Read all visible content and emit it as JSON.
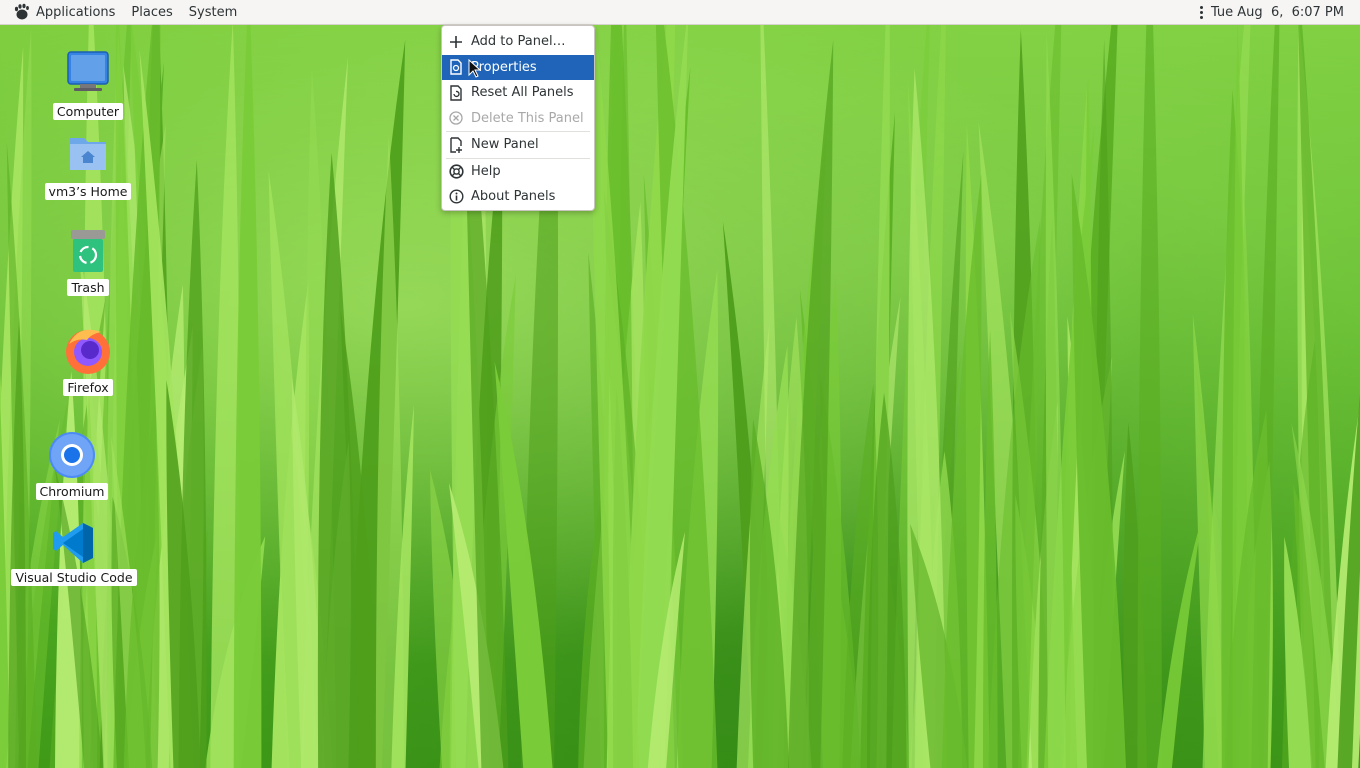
{
  "panel": {
    "menus": {
      "applications": "Applications",
      "places": "Places",
      "system": "System"
    },
    "clock": "Tue Aug  6,  6:07 PM"
  },
  "desktop": {
    "icons": [
      {
        "label": "Computer",
        "icon": "computer-icon"
      },
      {
        "label": "vm3’s Home",
        "icon": "home-folder-icon"
      },
      {
        "label": "Trash",
        "icon": "trash-icon"
      },
      {
        "label": "Firefox",
        "icon": "firefox-icon"
      },
      {
        "label": "Chromium",
        "icon": "chromium-icon"
      },
      {
        "label": "Visual Studio Code",
        "icon": "vscode-icon"
      }
    ]
  },
  "context_menu": {
    "items": [
      {
        "label": "Add to Panel…",
        "icon": "plus-icon",
        "state": "normal"
      },
      {
        "label": "Properties",
        "icon": "properties-icon",
        "state": "highlighted"
      },
      {
        "label": "Reset All Panels",
        "icon": "reset-icon",
        "state": "normal"
      },
      {
        "label": "Delete This Panel",
        "icon": "delete-icon",
        "state": "disabled"
      },
      {
        "label": "New Panel",
        "icon": "new-panel-icon",
        "state": "normal"
      },
      {
        "label": "Help",
        "icon": "help-icon",
        "state": "normal"
      },
      {
        "label": "About Panels",
        "icon": "info-icon",
        "state": "normal"
      }
    ]
  },
  "colors": {
    "highlight": "#1f64b8",
    "panel_bg": "#f6f5f4",
    "wallpaper": "#5db82a"
  }
}
